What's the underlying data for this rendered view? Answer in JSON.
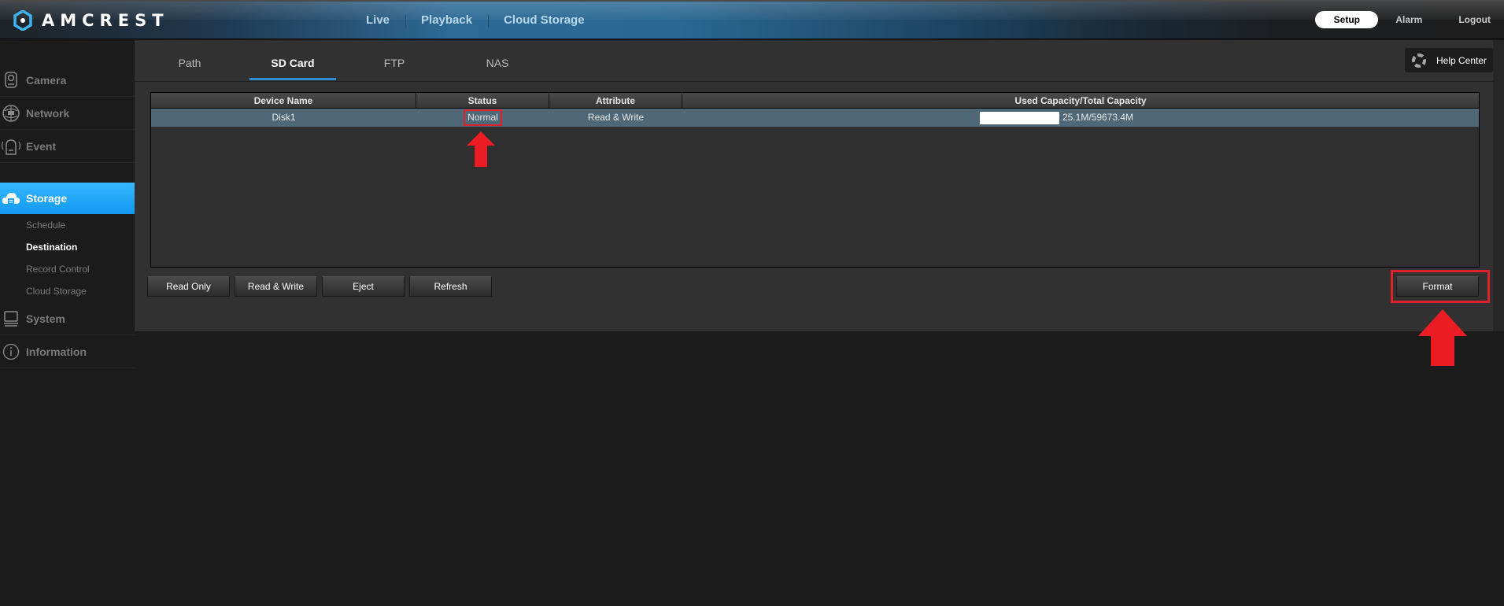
{
  "header": {
    "brand": "AMCREST",
    "nav": [
      "Live",
      "Playback",
      "Cloud Storage"
    ],
    "right": {
      "setup": "Setup",
      "alarm": "Alarm",
      "logout": "Logout"
    }
  },
  "sidebar": {
    "items": [
      {
        "label": "Camera",
        "icon": "camera-icon"
      },
      {
        "label": "Network",
        "icon": "network-icon"
      },
      {
        "label": "Event",
        "icon": "event-icon"
      },
      {
        "label": "Storage",
        "icon": "storage-icon",
        "active": true
      },
      {
        "label": "System",
        "icon": "system-icon"
      },
      {
        "label": "Information",
        "icon": "info-icon"
      }
    ],
    "storage_sub": [
      {
        "label": "Schedule"
      },
      {
        "label": "Destination",
        "active": true
      },
      {
        "label": "Record Control"
      },
      {
        "label": "Cloud Storage"
      }
    ]
  },
  "main": {
    "tabs": [
      {
        "label": "Path"
      },
      {
        "label": "SD Card",
        "active": true
      },
      {
        "label": "FTP"
      },
      {
        "label": "NAS"
      }
    ],
    "help_center": "Help Center",
    "table": {
      "columns": [
        "Device Name",
        "Status",
        "Attribute",
        "Used Capacity/Total Capacity"
      ],
      "rows": [
        {
          "device": "Disk1",
          "status": "Normal",
          "attribute": "Read & Write",
          "capacity": "25.1M/59673.4M",
          "used_fraction": 0.0004
        }
      ]
    },
    "buttons": {
      "read_only": "Read Only",
      "read_write": "Read & Write",
      "eject": "Eject",
      "refresh": "Refresh",
      "format": "Format"
    }
  },
  "annotations": {
    "highlight_color": "#e0202a",
    "highlighted": [
      "status-normal",
      "format-button"
    ]
  },
  "colors": {
    "accent": "#1aa3f5",
    "row_selected": "#4f6878",
    "tab_underline": "#2e8fd6"
  }
}
